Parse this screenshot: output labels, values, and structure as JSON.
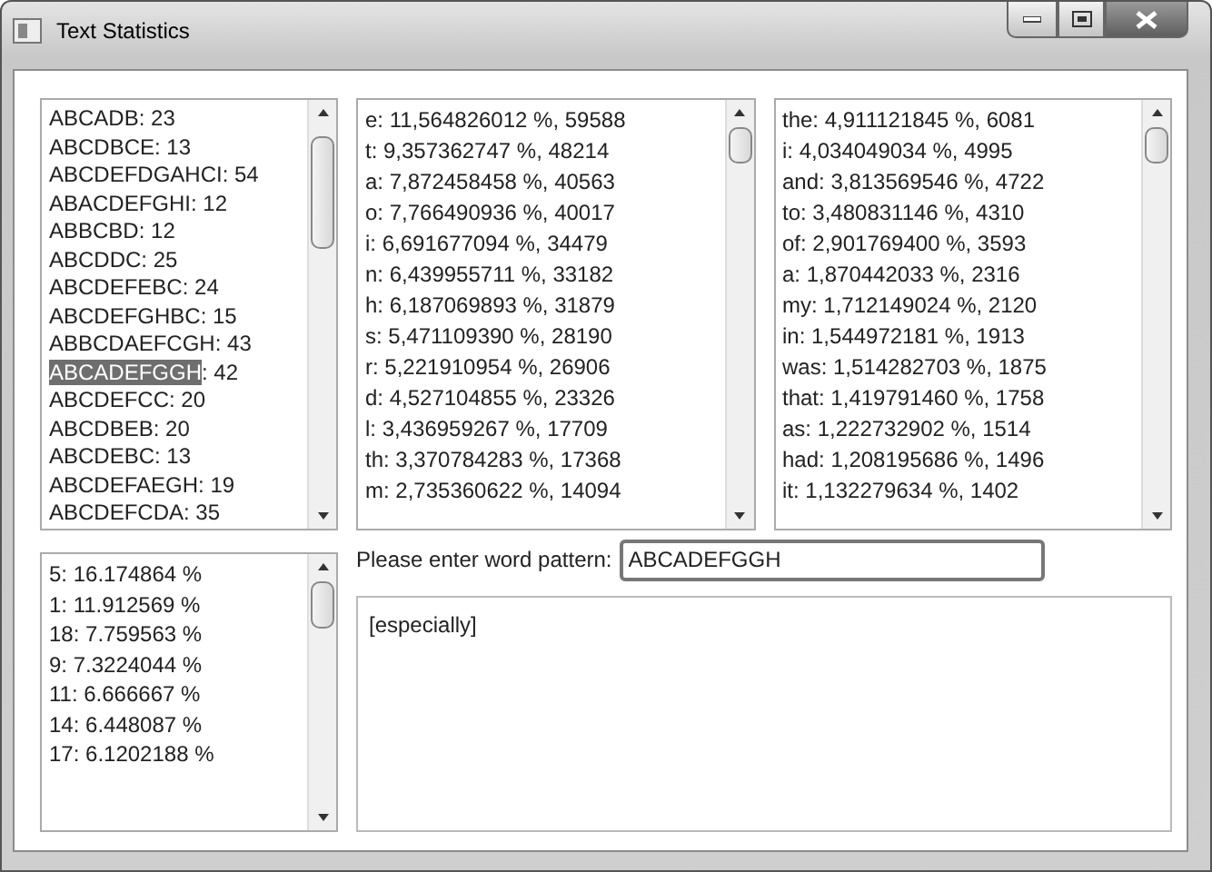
{
  "window": {
    "title": "Text Statistics"
  },
  "patterns": [
    {
      "word": "ABCADB",
      "suffix": ": 23",
      "highlighted": false
    },
    {
      "word": "ABCDBCE",
      "suffix": ": 13",
      "highlighted": false
    },
    {
      "word": "ABCDEFDGAHCI",
      "suffix": ": 54",
      "highlighted": false
    },
    {
      "word": "ABACDEFGHI",
      "suffix": ": 12",
      "highlighted": false
    },
    {
      "word": "ABBCBD",
      "suffix": ": 12",
      "highlighted": false
    },
    {
      "word": "ABCDDC",
      "suffix": ": 25",
      "highlighted": false
    },
    {
      "word": "ABCDEFEBC",
      "suffix": ": 24",
      "highlighted": false
    },
    {
      "word": "ABCDEFGHBC",
      "suffix": ": 15",
      "highlighted": false
    },
    {
      "word": "ABBCDAEFCGH",
      "suffix": ": 43",
      "highlighted": false
    },
    {
      "word": "ABCADEFGGH",
      "suffix": ": 42",
      "highlighted": true
    },
    {
      "word": "ABCDEFCC",
      "suffix": ": 20",
      "highlighted": false
    },
    {
      "word": "ABCDBEB",
      "suffix": ": 20",
      "highlighted": false
    },
    {
      "word": "ABCDEBC",
      "suffix": ": 13",
      "highlighted": false
    },
    {
      "word": "ABCDEFAEGH",
      "suffix": ": 19",
      "highlighted": false
    },
    {
      "word": "ABCDEFCDA",
      "suffix": ": 35",
      "highlighted": false
    }
  ],
  "letters": [
    "e: 11,564826012 %, 59588",
    "t: 9,357362747 %, 48214",
    "a: 7,872458458 %, 40563",
    "o: 7,766490936 %, 40017",
    "i: 6,691677094 %, 34479",
    "n: 6,439955711 %, 33182",
    "h: 6,187069893 %, 31879",
    "s: 5,471109390 %, 28190",
    "r: 5,221910954 %, 26906",
    "d: 4,527104855 %, 23326",
    "l: 3,436959267 %, 17709",
    "th: 3,370784283 %, 17368",
    "m: 2,735360622 %, 14094"
  ],
  "words": [
    "the: 4,911121845 %, 6081",
    "i: 4,034049034 %, 4995",
    "and: 3,813569546 %, 4722",
    "to: 3,480831146 %, 4310",
    "of: 2,901769400 %, 3593",
    "a: 1,870442033 %, 2316",
    "my: 1,712149024 %, 2120",
    "in: 1,544972181 %, 1913",
    "was: 1,514282703 %, 1875",
    "that: 1,419791460 %, 1758",
    "as: 1,222732902 %, 1514",
    "had: 1,208195686 %, 1496",
    "it: 1,132279634 %, 1402"
  ],
  "lengths": [
    "5: 16.174864 %",
    "1: 11.912569 %",
    "18: 7.759563 %",
    "9: 7.3224044 %",
    "11: 6.666667 %",
    "14: 6.448087 %",
    "17: 6.1202188 %"
  ],
  "pattern_input": {
    "label": "Please enter word pattern:",
    "value": "ABCADEFGGH"
  },
  "results": "[especially]"
}
